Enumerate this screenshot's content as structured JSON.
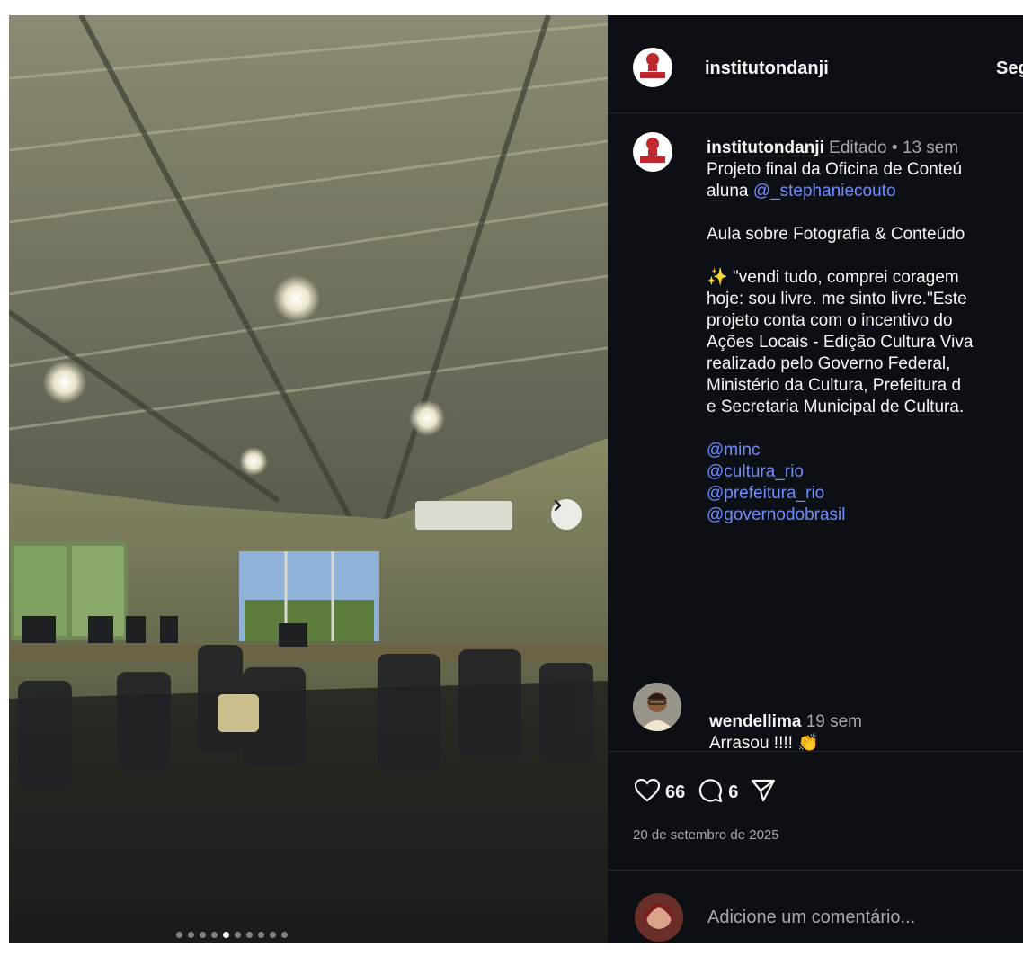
{
  "header": {
    "username": "institutondanji",
    "follow_label": "Seguir"
  },
  "caption": {
    "username": "institutondanji",
    "edited": "Editado",
    "separator": "•",
    "time": "13 sem",
    "line1": "Projeto final da Oficina de Conteú",
    "line2_prefix": "aluna ",
    "mention_student": "@_stephaniecouto",
    "line3": "Aula sobre Fotografia & Conteúdo",
    "sparkle": "✨",
    "quote_lines": [
      "\"vendi tudo, comprei coragem",
      "hoje: sou livre. me sinto livre.\"Este",
      "projeto conta com o incentivo do",
      "Ações Locais - Edição Cultura Viva",
      "realizado pelo Governo Federal,",
      "Ministério da Cultura, Prefeitura d",
      "e Secretaria Municipal de Cultura."
    ],
    "tags": [
      "@minc",
      "@cultura_rio",
      "@prefeitura_rio",
      "@governodobrasil"
    ]
  },
  "comment": {
    "username": "wendellima",
    "time": "19 sem",
    "text": "Arrasou !!!! 👏"
  },
  "actions": {
    "likes": "66",
    "comments": "6"
  },
  "post_date": "20 de setembro de 2025",
  "add_comment_placeholder": "Adicione um comentário...",
  "carousel": {
    "count": 10,
    "active_index": 4
  },
  "colors": {
    "background": "#0c1014",
    "link": "#6f8cff",
    "muted": "#a8a8a8",
    "text": "#f5f5f5",
    "logo_red": "#c0282d"
  },
  "icons": [
    "chevron-right-icon",
    "heart-icon",
    "comment-icon",
    "share-icon",
    "logo-icon"
  ]
}
